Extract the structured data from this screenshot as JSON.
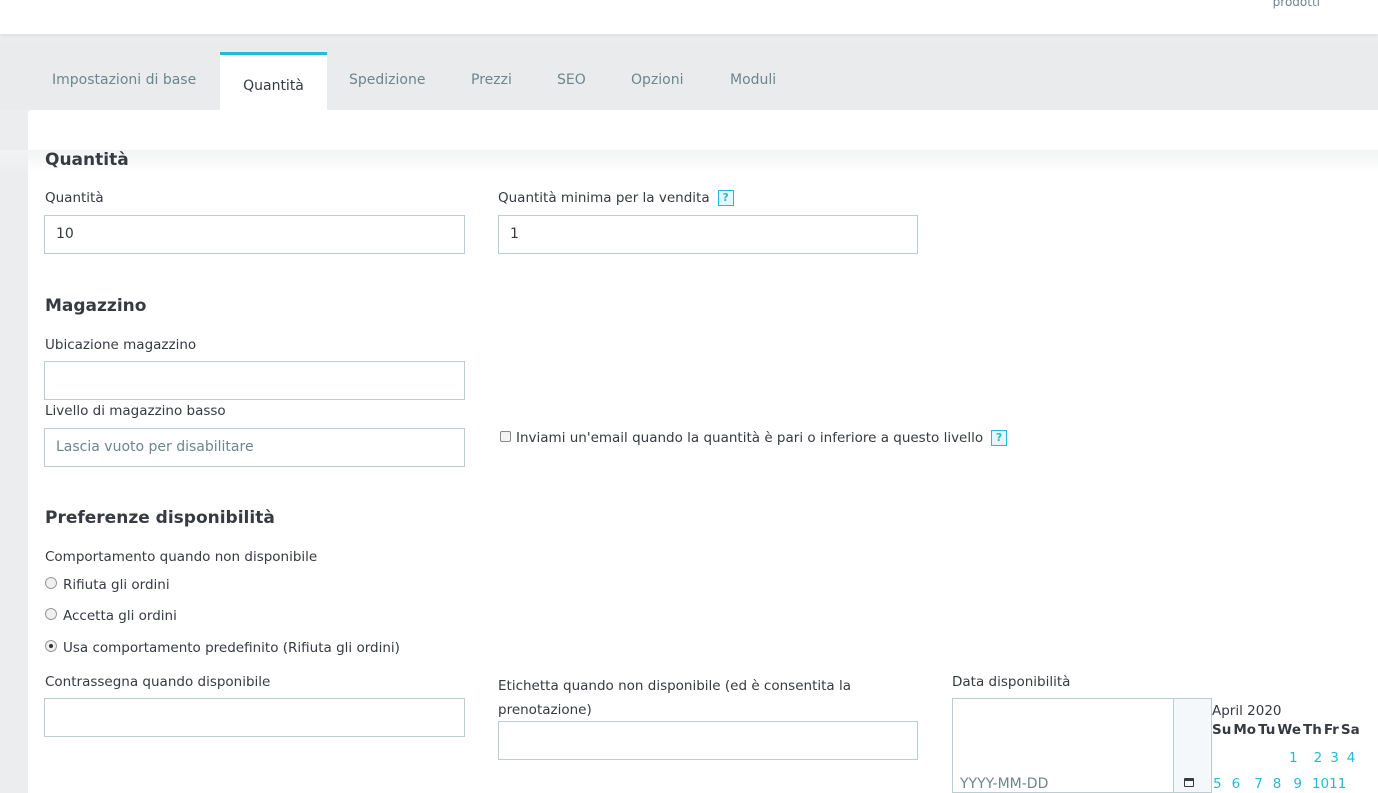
{
  "topbar": {
    "link_label": "prodotti"
  },
  "tabs": [
    {
      "label": "Impostazioni di base"
    },
    {
      "label": "Quantità"
    },
    {
      "label": "Spedizione"
    },
    {
      "label": "Prezzi"
    },
    {
      "label": "SEO"
    },
    {
      "label": "Opzioni"
    },
    {
      "label": "Moduli"
    }
  ],
  "active_tab": "Quantità",
  "quantities": {
    "title": "Quantità",
    "qty_label": "Quantità",
    "qty_value": "10",
    "min_qty_label": "Quantità minima per la vendita",
    "min_qty_value": "1",
    "help_glyph": "?"
  },
  "stock": {
    "title": "Magazzino",
    "location_label": "Ubicazione magazzino",
    "location_value": "",
    "low_stock_label": "Livello di magazzino basso",
    "low_stock_placeholder": "Lascia vuoto per disabilitare",
    "email_alert_label": "Inviami un'email quando la quantità è pari o inferiore a questo livello",
    "email_alert_checked": false,
    "help_glyph": "?"
  },
  "availability": {
    "title": "Preferenze disponibilità",
    "behavior_label": "Comportamento quando non disponibile",
    "options": [
      {
        "label": "Rifiuta gli ordini",
        "checked": false
      },
      {
        "label": "Accetta gli ordini",
        "checked": false
      },
      {
        "label": "Usa comportamento predefinito (Rifiuta gli ordini)",
        "checked": true
      }
    ],
    "in_stock_label": "Contrassegna quando disponibile",
    "in_stock_value": "",
    "out_of_stock_label_line1": "Etichetta quando non disponibile (ed è consentita la",
    "out_of_stock_label_line2": "prenotazione)",
    "out_of_stock_value": "",
    "date_label": "Data disponibilità",
    "date_placeholder": "YYYY-MM-DD"
  },
  "calendar": {
    "month": "April 2020",
    "weekdays": [
      "Su",
      "Mo",
      "Tu",
      "We",
      "Th",
      "Fr",
      "Sa"
    ],
    "week1": [
      "1",
      "2",
      "3",
      "4"
    ],
    "week2": [
      "5",
      "6",
      "7",
      "8",
      "9",
      "10",
      "11"
    ]
  },
  "colors": {
    "accent": "#25b9d7",
    "text": "#363a41",
    "muted": "#6c868e",
    "border": "#bbcdd2",
    "background": "#ebedef"
  },
  "icons": {
    "help": "help-icon",
    "calendar": "calendar-icon"
  }
}
